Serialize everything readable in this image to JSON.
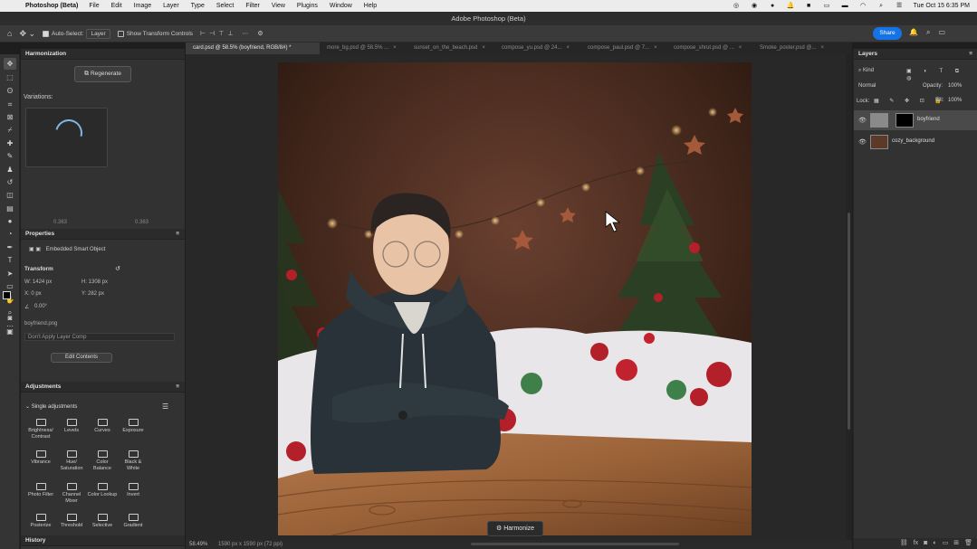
{
  "menubar": {
    "app": "Photoshop (Beta)",
    "items": [
      "File",
      "Edit",
      "Image",
      "Layer",
      "Type",
      "Select",
      "Filter",
      "View",
      "Plugins",
      "Window",
      "Help"
    ],
    "clock": "Tue Oct 15  6:35 PM"
  },
  "window_title": "Adobe Photoshop (Beta)",
  "options": {
    "auto_select_label": "Auto-Select:",
    "auto_select_value": "Layer",
    "show_transform": "Show Transform Controls",
    "share_label": "Share"
  },
  "tabs": [
    {
      "label": "card.psd @ 58.5% (boyfriend, RGB/8#) *",
      "active": true
    },
    {
      "label": "more_bg.psd @ 58.5% ...",
      "active": false
    },
    {
      "label": "sunset_on_the_beach.psd",
      "active": false
    },
    {
      "label": "compose_yu.psd @ 24...",
      "active": false
    },
    {
      "label": "compose_paul.psd @ 7...",
      "active": false
    },
    {
      "label": "compose_shrut.psd @ ...",
      "active": false
    },
    {
      "label": "Smoke_poster.psd @...",
      "active": false
    }
  ],
  "harmonization": {
    "title": "Harmonization",
    "regenerate": "Regenerate",
    "variations_label": "Variations:",
    "slider_left": "0.363",
    "slider_right": "0.363"
  },
  "properties": {
    "title": "Properties",
    "type": "Embedded Smart Object",
    "transform_label": "Transform",
    "w": "W: 1424 px",
    "h": "H: 1308 px",
    "x": "X: 0 px",
    "y": "Y: 282 px",
    "angle": "0.00°",
    "filename": "boyfriend.png",
    "layer_comp": "Don't Apply Layer Comp",
    "edit_contents": "Edit Contents"
  },
  "adjustments": {
    "title": "Adjustments",
    "section": "Single adjustments",
    "items": [
      "Brightness/ Contrast",
      "Levels",
      "Curves",
      "Exposure",
      "Vibrance",
      "Hue/ Saturation",
      "Color Balance",
      "Black & White",
      "Photo Filter",
      "Channel Mixer",
      "Color Lookup",
      "Invert",
      "Posterize",
      "Threshold",
      "Selective",
      "Gradient"
    ]
  },
  "history": {
    "title": "History"
  },
  "status": {
    "zoom": "58.49%",
    "dims": "1590 px x 1590 px (72 ppi)"
  },
  "harmonize_button": "Harmonize",
  "layers": {
    "title": "Layers",
    "kind": "Kind",
    "blend_mode": "Normal",
    "opacity_label": "Opacity:",
    "opacity_value": "100%",
    "lock_label": "Lock:",
    "fill_label": "Fill:",
    "fill_value": "100%",
    "items": [
      {
        "name": "boyfriend",
        "selected": true
      },
      {
        "name": "cozy_background",
        "selected": false
      }
    ]
  },
  "colors": {
    "accent": "#1473e6",
    "panel": "#323232",
    "canvas_bg": "#282828"
  }
}
